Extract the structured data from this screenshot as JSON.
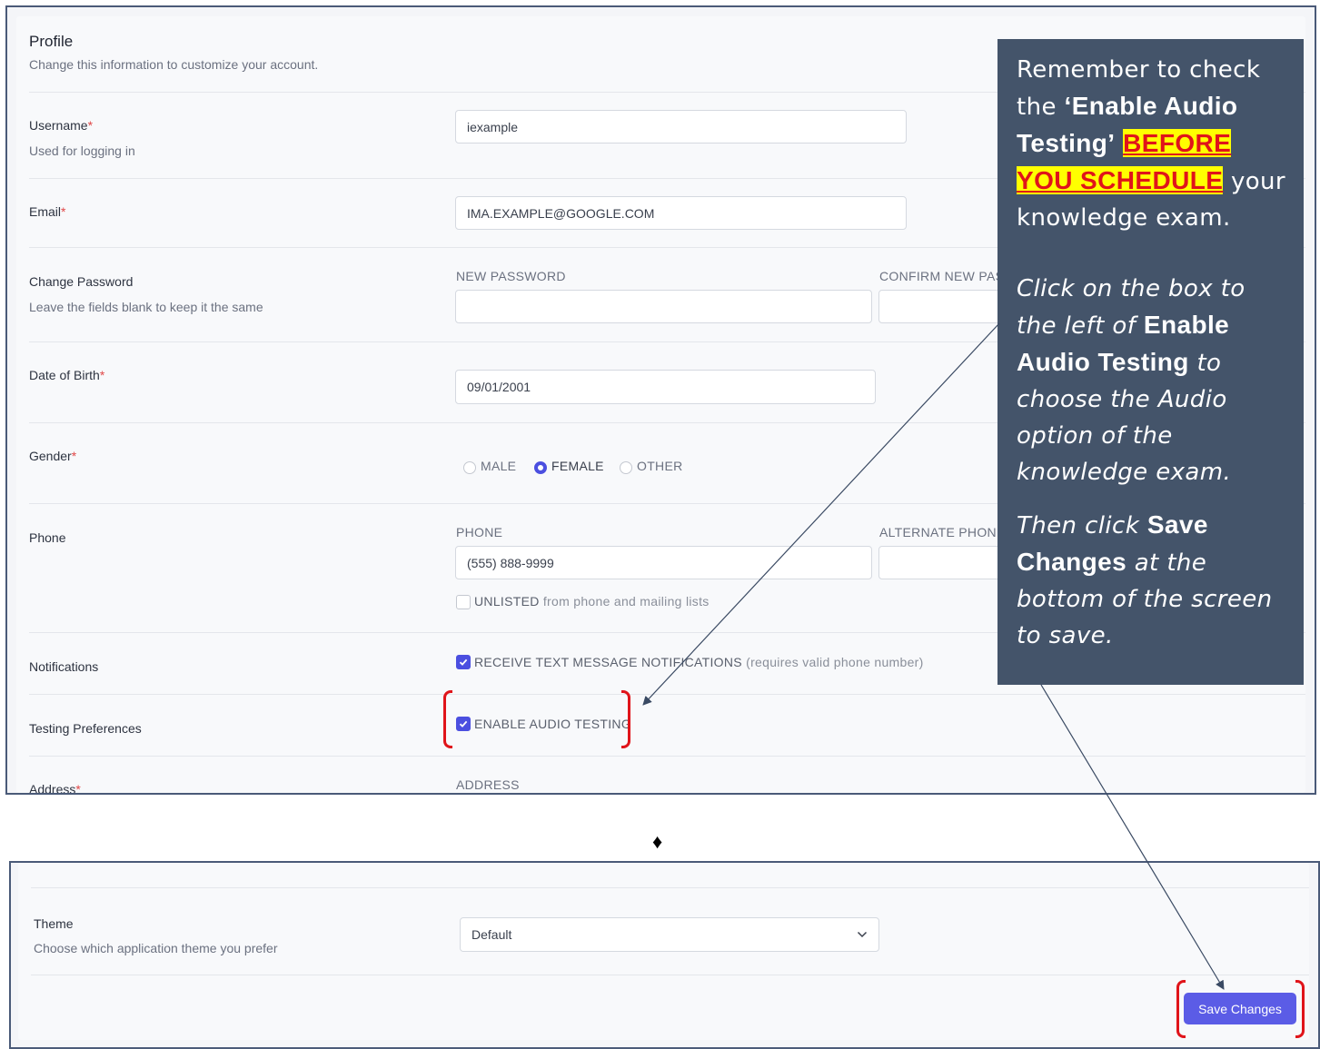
{
  "profile": {
    "title": "Profile",
    "subtitle": "Change this information to customize your account."
  },
  "username": {
    "label": "Username",
    "required_mark": "*",
    "hint": "Used for logging in",
    "value": "iexample"
  },
  "email": {
    "label": "Email",
    "required_mark": "*",
    "value": "IMA.EXAMPLE@GOOGLE.COM"
  },
  "password": {
    "label": "Change Password",
    "hint": "Leave the fields blank to keep it the same",
    "new_caption": "NEW PASSWORD",
    "confirm_caption": "CONFIRM NEW PAS",
    "new_value": "",
    "confirm_value": ""
  },
  "dob": {
    "label": "Date of Birth",
    "required_mark": "*",
    "value": "09/01/2001"
  },
  "gender": {
    "label": "Gender",
    "required_mark": "*",
    "options": [
      "MALE",
      "FEMALE",
      "OTHER"
    ],
    "selected": "FEMALE"
  },
  "phone": {
    "label": "Phone",
    "phone_caption": "PHONE",
    "alt_caption": "ALTERNATE PHONE",
    "value": "(555) 888-9999",
    "alt_value": "",
    "unlisted_label": "UNLISTED",
    "unlisted_suffix": "from phone and mailing lists",
    "unlisted_checked": false
  },
  "notifications": {
    "label": "Notifications",
    "option_label": "RECEIVE TEXT MESSAGE NOTIFICATIONS",
    "option_note": "(requires valid phone number)",
    "checked": true
  },
  "testing": {
    "label": "Testing Preferences",
    "option_label": "ENABLE AUDIO TESTING",
    "checked": true
  },
  "address": {
    "label": "Address",
    "required_mark": "*",
    "caption": "ADDRESS"
  },
  "separator_glyph": "♦",
  "theme": {
    "label": "Theme",
    "hint": "Choose which application theme you prefer",
    "selected": "Default"
  },
  "save_button": {
    "label": "Save Changes"
  },
  "callout": {
    "p1_a": "Remember to check the ",
    "p1_b": "‘Enable Audio Testing’",
    "p1_hl": "BEFORE YOU SCHEDULE",
    "p1_c": " your knowledge exam.",
    "p2_a": "Click on the box to the left of ",
    "p2_b": "Enable Audio Testing",
    "p2_c": " to choose the Audio option of the knowledge exam.",
    "p3_a": "Then click ",
    "p3_b": "Save Changes",
    "p3_c": " at the bottom of the screen to save."
  },
  "colors": {
    "accent": "#4b4fe0",
    "button": "#5b5ce6",
    "callout_bg": "#44546a",
    "highlight": "#ffff00",
    "annotation_red": "#e0141a",
    "required_star": "#e04848"
  }
}
